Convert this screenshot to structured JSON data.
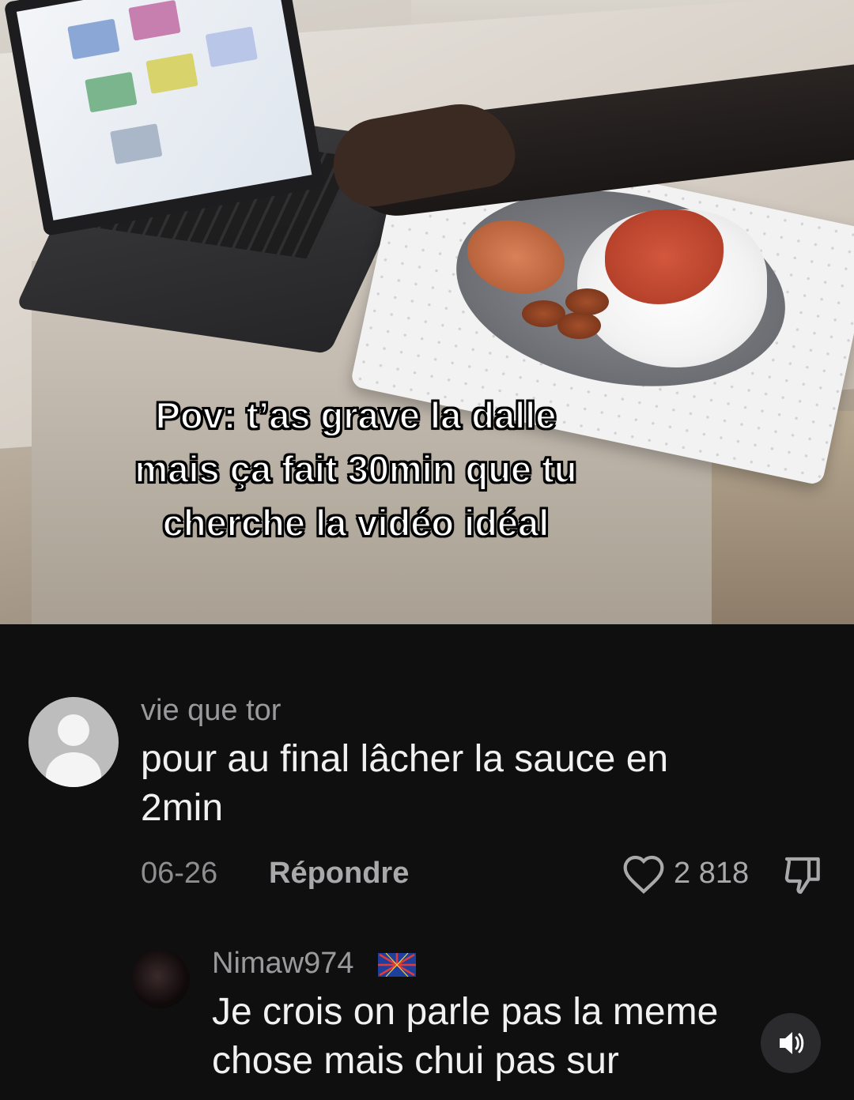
{
  "video": {
    "caption": "Pov: t’as grave la dalle\nmais ça fait 30min que tu\ncherche la vidéo idéal"
  },
  "comments": [
    {
      "username": "vie que tor",
      "text": "pour au final lâcher la sauce en\n2min",
      "date": "06-26",
      "reply_label": "Répondre",
      "likes": "2 818"
    },
    {
      "username": "Nimaw974",
      "text": "Je crois on parle pas la meme\nchose mais chui pas sur"
    }
  ],
  "icons": {
    "like": "heart-icon",
    "dislike": "thumbs-down-icon",
    "sound": "speaker-icon",
    "avatar_default": "person-icon",
    "flag": "flag-icon"
  },
  "colors": {
    "background": "#0f0f10",
    "username": "#9a9a9c",
    "comment_text": "#f1f1f1"
  }
}
